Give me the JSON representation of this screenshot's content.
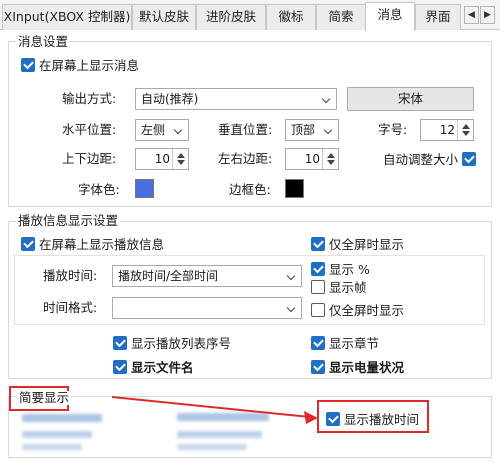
{
  "tabs": [
    {
      "label": "XInput(XBOX 控制器)",
      "active": false
    },
    {
      "label": "默认皮肤",
      "active": false
    },
    {
      "label": "进阶皮肤",
      "active": false
    },
    {
      "label": "徽标",
      "active": false
    },
    {
      "label": "简索",
      "active": false
    },
    {
      "label": "消息",
      "active": true
    },
    {
      "label": "界面",
      "active": false
    }
  ],
  "message_group": {
    "title": "消息设置",
    "show_on_screen": {
      "label": "在屏幕上显示消息",
      "checked": true
    },
    "output_mode": {
      "label": "输出方式:",
      "value": "自动(推荐)"
    },
    "font_button": "宋体",
    "h_pos": {
      "label": "水平位置:",
      "value": "左侧"
    },
    "v_pos": {
      "label": "垂直位置:",
      "value": "顶部"
    },
    "font_size": {
      "label": "字号:",
      "value": "12"
    },
    "tb_margin": {
      "label": "上下边距:",
      "value": "10"
    },
    "lr_margin": {
      "label": "左右边距:",
      "value": "10"
    },
    "auto_size": {
      "label": "自动调整大小",
      "checked": true
    },
    "font_color": {
      "label": "字体色:",
      "color": "#4a6ee0"
    },
    "border_color": {
      "label": "边框色:",
      "color": "#000000"
    }
  },
  "playback_group": {
    "title": "播放信息显示设置",
    "show_playback": {
      "label": "在屏幕上显示播放信息",
      "checked": true
    },
    "fullscreen_only_1": {
      "label": "仅全屏时显示",
      "checked": true
    },
    "play_time": {
      "label": "播放时间:",
      "value": "播放时间/全部时间"
    },
    "show_percent": {
      "label": "显示 %",
      "checked": true
    },
    "show_frames": {
      "label": "显示帧",
      "checked": false
    },
    "time_format": {
      "label": "时间格式:",
      "value": ""
    },
    "fullscreen_only_2": {
      "label": "仅全屏时显示",
      "checked": false
    },
    "show_playlist_no": {
      "label": "显示播放列表序号",
      "checked": true
    },
    "show_chapter": {
      "label": "显示章节",
      "checked": true
    },
    "show_filename": {
      "label": "显示文件名",
      "checked": true
    },
    "show_battery": {
      "label": "显示电量状况",
      "checked": true
    }
  },
  "brief_group": {
    "title": "简要显示",
    "show_play_time": {
      "label": "显示播放时间",
      "checked": true
    }
  },
  "colors": {
    "accent": "#1f6fc5",
    "highlight": "#e02a2a"
  }
}
